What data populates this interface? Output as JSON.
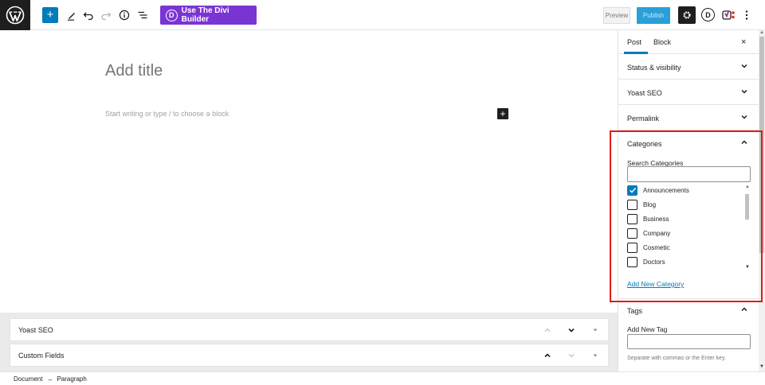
{
  "colors": {
    "accent": "#007cba",
    "divi": "#7b34d4",
    "publish": "#2a9fd8",
    "highlight": "#e21b1b"
  },
  "toolbar": {
    "add_label": "+",
    "divi_label": "Use The Divi Builder",
    "divi_letter": "D",
    "preview_label": "Preview",
    "publish_label": "Publish",
    "divi_icon_letter": "D",
    "icons": [
      "wordpress-icon",
      "add-block-icon",
      "pencil-icon",
      "undo-icon",
      "redo-icon",
      "info-icon",
      "outline-icon",
      "gear-icon",
      "divi-icon",
      "yoast-icon",
      "more-icon"
    ]
  },
  "editor": {
    "title_placeholder": "Add title",
    "block_placeholder": "Start writing or type / to choose a block",
    "inline_add": "+"
  },
  "metaboxes": [
    {
      "label": "Yoast SEO"
    },
    {
      "label": "Custom Fields"
    }
  ],
  "footer": {
    "crumb_1": "Document",
    "sep": "→",
    "crumb_2": "Paragraph"
  },
  "sidebar": {
    "tab_post": "Post",
    "tab_block": "Block",
    "close": "×",
    "panels": [
      {
        "label": "Status & visibility"
      },
      {
        "label": "Yoast SEO"
      },
      {
        "label": "Permalink"
      }
    ],
    "categories": {
      "title": "Categories",
      "search_label": "Search Categories",
      "search_value": "",
      "items": [
        {
          "label": "Announcements",
          "checked": true
        },
        {
          "label": "Blog",
          "checked": false
        },
        {
          "label": "Business",
          "checked": false
        },
        {
          "label": "Company",
          "checked": false
        },
        {
          "label": "Cosmetic",
          "checked": false
        },
        {
          "label": "Doctors",
          "checked": false
        }
      ],
      "add_new": "Add New Category"
    },
    "tags": {
      "title": "Tags",
      "label": "Add New Tag",
      "value": "",
      "help": "Separate with commas or the Enter key."
    }
  }
}
